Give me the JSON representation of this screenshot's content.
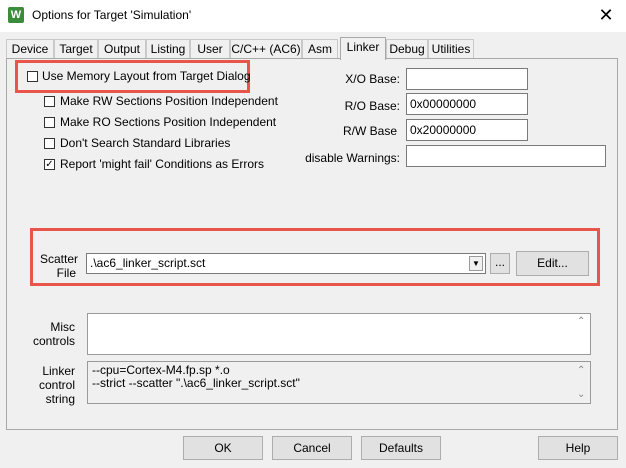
{
  "window": {
    "title": "Options for Target 'Simulation'",
    "close": "✕",
    "app_icon": "W"
  },
  "tabs": [
    {
      "label": "Device"
    },
    {
      "label": "Target"
    },
    {
      "label": "Output"
    },
    {
      "label": "Listing"
    },
    {
      "label": "User"
    },
    {
      "label": "C/C++ (AC6)"
    },
    {
      "label": "Asm"
    },
    {
      "label": "Linker"
    },
    {
      "label": "Debug"
    },
    {
      "label": "Utilities"
    }
  ],
  "active_tab": "Linker",
  "options": {
    "use_memory_layout": {
      "label": "Use Memory Layout from Target Dialog",
      "checked": false
    },
    "rw_pos_indep": {
      "label": "Make RW Sections Position Independent",
      "checked": false
    },
    "ro_pos_indep": {
      "label": "Make RO Sections Position Independent",
      "checked": false
    },
    "dont_search_libs": {
      "label": "Don't Search Standard Libraries",
      "checked": false
    },
    "report_might_fail": {
      "label": "Report 'might fail' Conditions as Errors",
      "checked": true,
      "mark": "✓"
    }
  },
  "bases": {
    "xo": {
      "label": "X/O Base:",
      "value": ""
    },
    "ro": {
      "label": "R/O Base:",
      "value": "0x00000000"
    },
    "rw": {
      "label": "R/W Base",
      "value": "0x20000000"
    },
    "warnings": {
      "label": "disable Warnings:",
      "value": ""
    }
  },
  "scatter": {
    "label_line1": "Scatter",
    "label_line2": "File",
    "value": ".\\ac6_linker_script.sct",
    "browse": "...",
    "edit": "Edit..."
  },
  "misc": {
    "label_line1": "Misc",
    "label_line2": "controls",
    "value": ""
  },
  "linker_control": {
    "label_line1": "Linker",
    "label_line2": "control",
    "label_line3": "string",
    "line1": "--cpu=Cortex-M4.fp.sp *.o",
    "line2": "--strict --scatter \".\\ac6_linker_script.sct\""
  },
  "buttons": {
    "ok": "OK",
    "cancel": "Cancel",
    "defaults": "Defaults",
    "help": "Help"
  },
  "colors": {
    "highlight": "#e8554b",
    "dialog_bg": "#f0f0f0"
  }
}
